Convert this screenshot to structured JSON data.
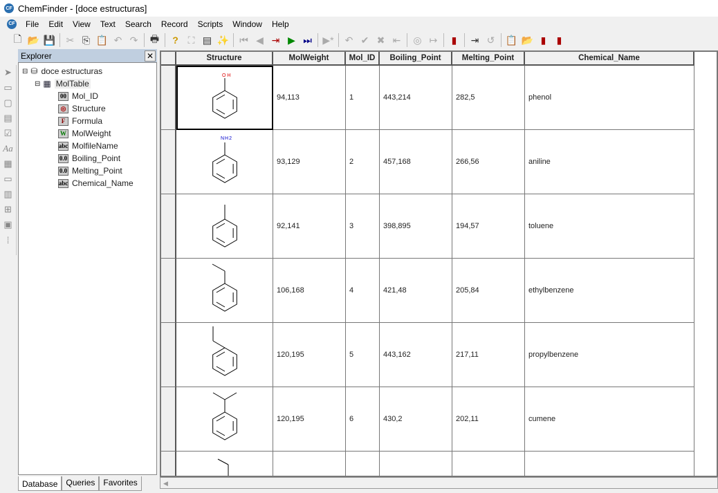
{
  "window": {
    "title": "ChemFinder - [doce estructuras]",
    "app_icon": "CF"
  },
  "menu": [
    "File",
    "Edit",
    "View",
    "Text",
    "Search",
    "Record",
    "Scripts",
    "Window",
    "Help"
  ],
  "explorer": {
    "title": "Explorer",
    "database": "doce estructuras",
    "table": "MolTable",
    "fields": [
      {
        "name": "Mol_ID",
        "icon": "00"
      },
      {
        "name": "Structure",
        "icon": "◎"
      },
      {
        "name": "Formula",
        "icon": "F"
      },
      {
        "name": "MolWeight",
        "icon": "W"
      },
      {
        "name": "MolfileName",
        "icon": "abc"
      },
      {
        "name": "Boiling_Point",
        "icon": "0.0"
      },
      {
        "name": "Melting_Point",
        "icon": "0.0"
      },
      {
        "name": "Chemical_Name",
        "icon": "abc"
      }
    ],
    "tabs": [
      "Database",
      "Queries",
      "Favorites"
    ]
  },
  "grid": {
    "columns": [
      "Structure",
      "MolWeight",
      "Mol_ID",
      "Boiling_Point",
      "Melting_Point",
      "Chemical_Name"
    ],
    "rows": [
      {
        "substituent": "OH",
        "molweight": "94,113",
        "mol_id": "1",
        "boiling": "443,214",
        "melting": "282,5",
        "name": "phenol"
      },
      {
        "substituent": "NH2",
        "molweight": "93,129",
        "mol_id": "2",
        "boiling": "457,168",
        "melting": "266,56",
        "name": "aniline"
      },
      {
        "substituent": "methyl",
        "molweight": "92,141",
        "mol_id": "3",
        "boiling": "398,895",
        "melting": "194,57",
        "name": "toluene"
      },
      {
        "substituent": "ethyl",
        "molweight": "106,168",
        "mol_id": "4",
        "boiling": "421,48",
        "melting": "205,84",
        "name": "ethylbenzene"
      },
      {
        "substituent": "propyl",
        "molweight": "120,195",
        "mol_id": "5",
        "boiling": "443,162",
        "melting": "217,11",
        "name": "propylbenzene"
      },
      {
        "substituent": "isopropyl",
        "molweight": "120,195",
        "mol_id": "6",
        "boiling": "430,2",
        "melting": "202,11",
        "name": "cumene"
      },
      {
        "substituent": "butyl",
        "molweight": "",
        "mol_id": "",
        "boiling": "",
        "melting": "",
        "name": ""
      }
    ]
  }
}
